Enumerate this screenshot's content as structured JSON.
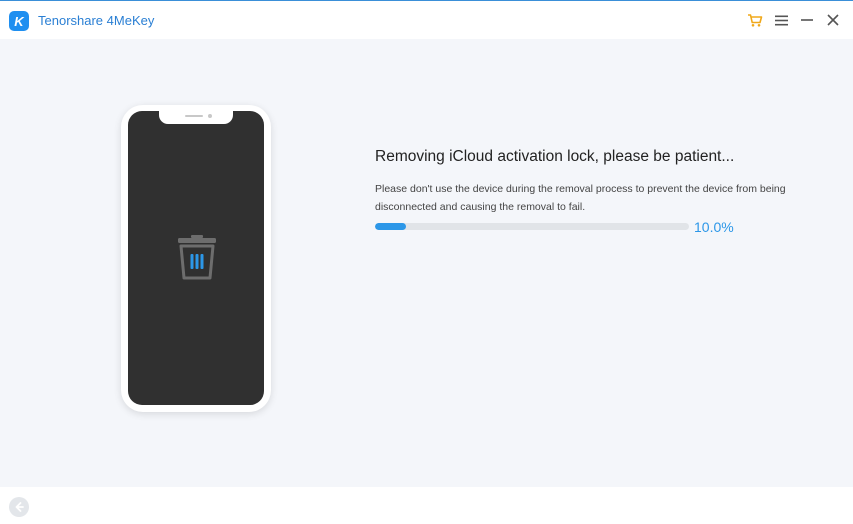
{
  "app": {
    "title": "Tenorshare 4MeKey",
    "logo_letter": "K",
    "accent_color": "#1f8ff0",
    "cart_color": "#f0a81a"
  },
  "titlebar": {
    "icons": [
      "cart-icon",
      "menu-icon",
      "minimize-icon",
      "close-icon"
    ]
  },
  "status": {
    "title": "Removing iCloud activation lock, please be patient...",
    "description": "Please don't use the device during the removal process to prevent the device from being disconnected and causing the removal to fail.",
    "progress_value": 0.1,
    "progress_label": "10.0%"
  },
  "phone": {
    "screen_icon": "trash-icon"
  },
  "footer": {
    "back_icon": "back-arrow-icon"
  }
}
